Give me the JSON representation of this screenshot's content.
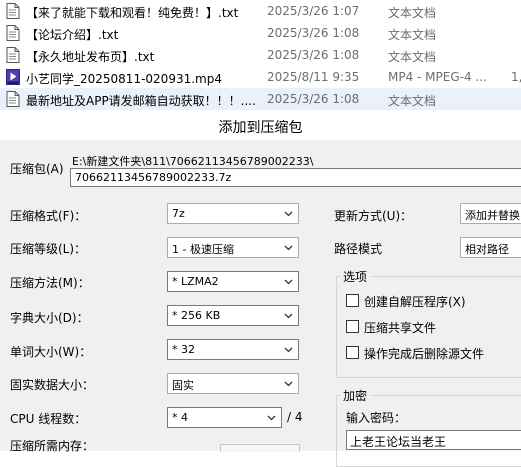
{
  "files": [
    {
      "name": "【来了就能下载和观看！纯免费！】.txt",
      "date": "2025/3/26 1:07",
      "type": "文本文档",
      "size": "",
      "icon": "txt-file-icon",
      "selected": false
    },
    {
      "name": "【论坛介绍】.txt",
      "date": "2025/3/26 1:08",
      "type": "文本文档",
      "size": "",
      "icon": "txt-file-icon",
      "selected": false
    },
    {
      "name": "【永久地址发布页】.txt",
      "date": "2025/3/26 1:08",
      "type": "文本文档",
      "size": "",
      "icon": "txt-file-icon",
      "selected": false
    },
    {
      "name": "小艺同学_20250811-020931.mp4",
      "date": "2025/8/11 9:35",
      "type": "MP4 - MPEG-4 ...",
      "size": "1,",
      "icon": "mp4-file-icon",
      "selected": false
    },
    {
      "name": "最新地址及APP请发邮箱自动获取！！！....",
      "date": "2025/3/26 1:08",
      "type": "文本文档",
      "size": "",
      "icon": "txt-file-icon",
      "selected": true
    }
  ],
  "dialog": {
    "title": "添加到压缩包",
    "archive_label": "压缩包(A)",
    "archive_path": "E:\\新建文件夹\\811\\70662113456789002233\\",
    "archive_name": "70662113456789002233.7z",
    "format_label": "压缩格式(F)：",
    "format_value": "7z",
    "level_label": "压缩等级(L)：",
    "level_value": "1 - 极速压缩",
    "method_label": "压缩方法(M)：",
    "method_value": "* LZMA2",
    "dict_label": "字典大小(D)：",
    "dict_value": "* 256 KB",
    "word_label": "单词大小(W)：",
    "word_value": "* 32",
    "solid_label": "固实数据大小：",
    "solid_value": "固实",
    "cpu_label": "CPU 线程数：",
    "cpu_value": "* 4",
    "cpu_total": "/ 4",
    "memory_label": "压缩所需内存：",
    "update_label": "更新方式(U)：",
    "update_value": "添加并替换",
    "pathmode_label": "路径模式",
    "pathmode_value": "相对路径",
    "options_title": "选项",
    "opt_sfx": "创建自解压程序(X)",
    "opt_shared": "压缩共享文件",
    "opt_delete": "操作完成后删除源文件",
    "encrypt_title": "加密",
    "password_label": "输入密码：",
    "password_value": "上老王论坛当老王"
  },
  "colors": {
    "selected_row": "#eaf1fb",
    "dialog_bg": "#f0f0f0",
    "secondary_text": "#6d6d6d"
  }
}
